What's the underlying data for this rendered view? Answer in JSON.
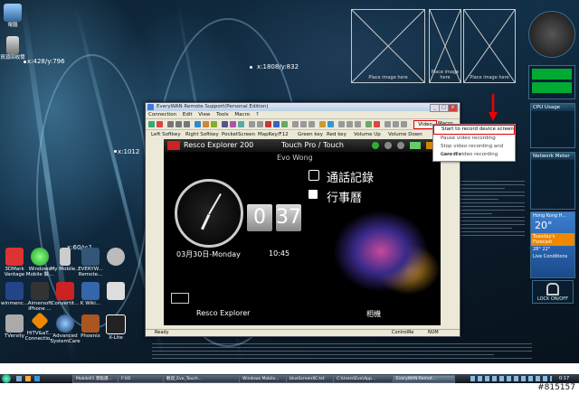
{
  "desktop": {
    "coord_labels": [
      "x:428/y:796",
      "x:1808/y:832",
      "x:1012",
      "x:60/y:1"
    ],
    "top_icons": [
      {
        "label": "電腦",
        "icon": "computer-icon"
      },
      {
        "label": "資源回收筒",
        "icon": "recycle-bin-icon"
      }
    ],
    "left_icons": [
      {
        "label": "3DMark Vantage",
        "icon": "3dmark-icon"
      },
      {
        "label": "Windows Mobile 裝...",
        "icon": "windows-mobile-icon"
      },
      {
        "label": "My Mobile...",
        "icon": "my-mobile-icon"
      },
      {
        "label": "EVERYW... Remote...",
        "icon": "everywan-icon"
      },
      {
        "label": "",
        "icon": "dog-icon"
      },
      {
        "label": "winmenc...",
        "icon": "winmenc-icon"
      },
      {
        "label": "Aimersoft iPhone ...",
        "icon": "aimersoft-icon"
      },
      {
        "label": "Convertit...",
        "icon": "convertit-icon"
      },
      {
        "label": "K Wiki...",
        "icon": "kwiki-icon"
      },
      {
        "label": "",
        "icon": "app-icon"
      },
      {
        "label": "TVersity",
        "icon": "tversity-icon"
      },
      {
        "label": "HiTV&aT... Connectio...",
        "icon": "hitv-icon"
      },
      {
        "label": "Advanced SystemCare",
        "icon": "systemcare-icon"
      },
      {
        "label": "Phoenix",
        "icon": "phoenix-icon"
      },
      {
        "label": "X-Lite",
        "icon": "xlite-icon"
      }
    ],
    "placeholders": [
      "Place image here",
      "Place image here",
      "Place image here"
    ]
  },
  "gadgets": {
    "cpu_title": "CPU Usage",
    "network_title": "Network Meter",
    "weather_city": "Hong Kong H...",
    "weather_temp": "20°",
    "weather_forecast": "Tuesday's Forecast",
    "weather_low": "28°",
    "weather_high": "22°",
    "weather_link": "Live Conditions",
    "lock_label": "LOCK ON/OFF"
  },
  "app": {
    "title": "EveryWAN Remote Support(Personal Edition)",
    "menu": [
      "Connection",
      "Edit",
      "View",
      "Tools",
      "Macro",
      "?"
    ],
    "video_button": "Video",
    "macro_button": "Macro",
    "softkeys": [
      "Left Softkey",
      "Right Softkey",
      "PocketScreen",
      "MapKey/F12",
      "Green key",
      "Red key",
      "Volume Up",
      "Volume Down"
    ],
    "status_ready": "Ready",
    "status_control": "ControlRe",
    "status_num": "NUM"
  },
  "video_menu": {
    "items": [
      "Start to record device screen",
      "Pause video recording",
      "Stop video recording and save file",
      "Cancel video recording"
    ]
  },
  "device": {
    "top_app": "Resco Explorer 200",
    "top_profile": "Touch Pro / Touch",
    "owner": "Evo Wong",
    "call_log": "通話記錄",
    "calendar": "行事曆",
    "hour": "0",
    "minute": "37",
    "date": "03月30日-Monday",
    "time": "10:45",
    "bottom_left": "Resco Explorer",
    "bottom_right": "相機"
  },
  "taskbar": {
    "tasks": [
      "Mobile01 景點選...",
      "F:\\IO",
      "歡迎_Evo_Touch...",
      "Windows Mobile...",
      "blueScreenXC.txt",
      "C:\\Users\\Evo\\App...",
      "EveryWAN Remot..."
    ],
    "clock": "0:17"
  },
  "watermark": "#815157"
}
